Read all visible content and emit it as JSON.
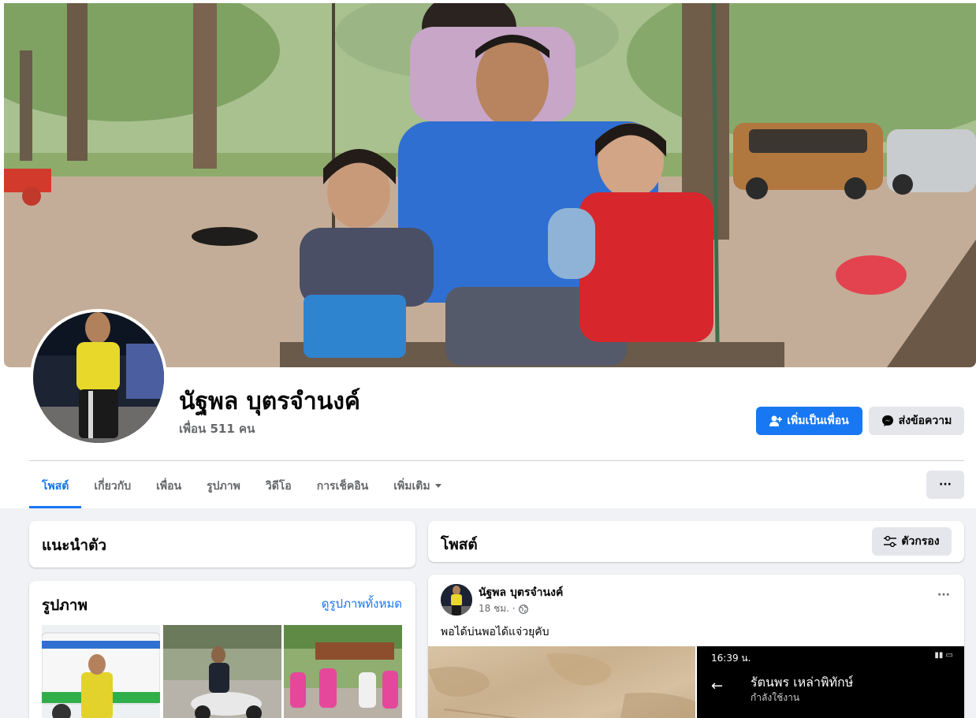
{
  "colors": {
    "accent": "#1877f2",
    "secondary_bg": "#e4e6eb",
    "page_bg": "#f0f2f5",
    "muted_text": "#65676b"
  },
  "profile": {
    "name": "นัฐพล บุตรจำนงค์",
    "friends": "เพื่อน 511 คน",
    "add_friend_label": "เพิ่มเป็นเพื่อน",
    "message_label": "ส่งข้อความ",
    "add_friend_icon": "add-friend-icon",
    "messenger_icon": "messenger-icon"
  },
  "tabs": [
    {
      "label": "โพสต์",
      "active": true
    },
    {
      "label": "เกี่ยวกับ"
    },
    {
      "label": "เพื่อน"
    },
    {
      "label": "รูปภาพ"
    },
    {
      "label": "วิดีโอ"
    },
    {
      "label": "การเช็คอิน"
    },
    {
      "label": "เพิ่มเติม"
    }
  ],
  "more_button": "···",
  "intro": {
    "title": "แนะนำตัว"
  },
  "photos": {
    "title": "รูปภาพ",
    "see_all": "ดูรูปภาพทั้งหมด"
  },
  "posts": {
    "title": "โพสต์",
    "filter_label": "ตัวกรอง",
    "filter_icon": "filter-icon"
  },
  "post": {
    "author": "นัฐพล บุตรจำนงค์",
    "time": "18 ชม. ·",
    "privacy_icon": "globe-icon",
    "more": "···",
    "text": "พอได้บ่นพอได้แจ่วยุคับ",
    "screenshot": {
      "time": "16:39 น.",
      "contact_name": "รัตนพร เหล่าพิทักษ์",
      "contact_status": "กำลังใช้งาน"
    }
  }
}
